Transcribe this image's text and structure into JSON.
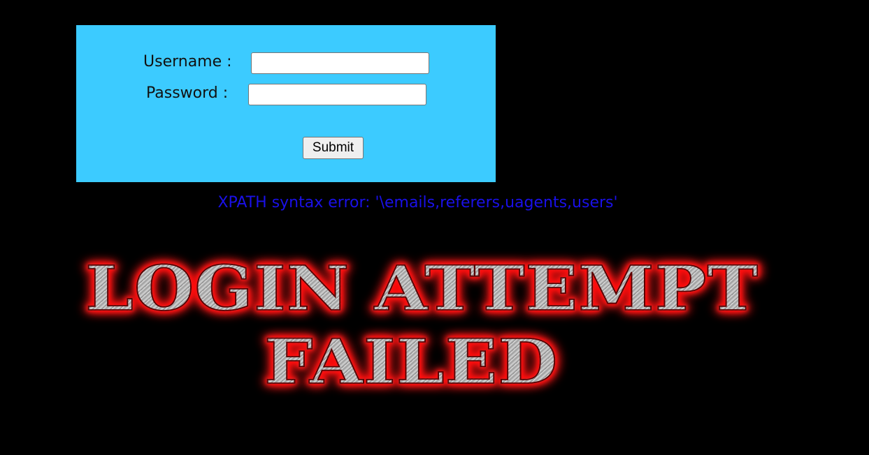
{
  "login_form": {
    "username_label": "Username :",
    "password_label": "Password :",
    "username_value": "",
    "password_value": "",
    "submit_label": "Submit",
    "panel_color": "#3ccbff"
  },
  "error": {
    "message": "XPATH syntax error: '\\emails,referers,uagents,users'",
    "color": "#1a10e8"
  },
  "banner": {
    "line1": "LOGIN ATTEMPT",
    "line2": "FAILED",
    "glow_color": "#ff0000"
  },
  "page": {
    "background": "#000000"
  }
}
